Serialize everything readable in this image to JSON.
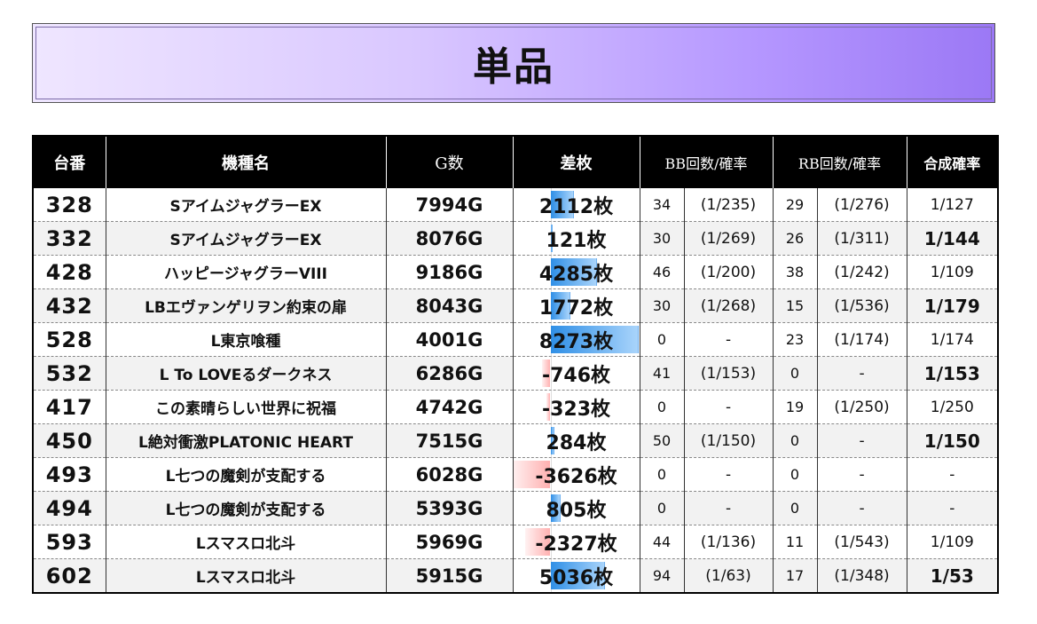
{
  "title": "単品",
  "headers": {
    "machine_no": "台番",
    "model": "機種名",
    "games": "G数",
    "diff": "差枚",
    "bb": "BB回数/確率",
    "rb": "RB回数/確率",
    "combined": "合成確率"
  },
  "diff_scale_max": 8273,
  "rows": [
    {
      "no": "328",
      "model": "SアイムジャグラーEX",
      "games": "7994G",
      "diff": "2112枚",
      "diff_value": 2112,
      "bb": "34",
      "bb_prob": "(1/235)",
      "rb": "29",
      "rb_prob": "(1/276)",
      "combined": "1/127",
      "emph": false
    },
    {
      "no": "332",
      "model": "SアイムジャグラーEX",
      "games": "8076G",
      "diff": "121枚",
      "diff_value": 121,
      "bb": "30",
      "bb_prob": "(1/269)",
      "rb": "26",
      "rb_prob": "(1/311)",
      "combined": "1/144",
      "emph": true
    },
    {
      "no": "428",
      "model": "ハッピージャグラーVIII",
      "games": "9186G",
      "diff": "4285枚",
      "diff_value": 4285,
      "bb": "46",
      "bb_prob": "(1/200)",
      "rb": "38",
      "rb_prob": "(1/242)",
      "combined": "1/109",
      "emph": false
    },
    {
      "no": "432",
      "model": "LBエヴァンゲリヲン約束の扉",
      "games": "8043G",
      "diff": "1772枚",
      "diff_value": 1772,
      "bb": "30",
      "bb_prob": "(1/268)",
      "rb": "15",
      "rb_prob": "(1/536)",
      "combined": "1/179",
      "emph": true
    },
    {
      "no": "528",
      "model": "L東京喰種",
      "games": "4001G",
      "diff": "8273枚",
      "diff_value": 8273,
      "bb": "0",
      "bb_prob": "-",
      "rb": "23",
      "rb_prob": "(1/174)",
      "combined": "1/174",
      "emph": false
    },
    {
      "no": "532",
      "model": "L To LOVEるダークネス",
      "games": "6286G",
      "diff": "-746枚",
      "diff_value": -746,
      "bb": "41",
      "bb_prob": "(1/153)",
      "rb": "0",
      "rb_prob": "-",
      "combined": "1/153",
      "emph": true
    },
    {
      "no": "417",
      "model": "この素晴らしい世界に祝福",
      "games": "4742G",
      "diff": "-323枚",
      "diff_value": -323,
      "bb": "0",
      "bb_prob": "-",
      "rb": "19",
      "rb_prob": "(1/250)",
      "combined": "1/250",
      "emph": false
    },
    {
      "no": "450",
      "model": "L絶対衝激PLATONIC HEART",
      "games": "7515G",
      "diff": "284枚",
      "diff_value": 284,
      "bb": "50",
      "bb_prob": "(1/150)",
      "rb": "0",
      "rb_prob": "-",
      "combined": "1/150",
      "emph": true
    },
    {
      "no": "493",
      "model": "L七つの魔剣が支配する",
      "games": "6028G",
      "diff": "-3626枚",
      "diff_value": -3626,
      "bb": "0",
      "bb_prob": "-",
      "rb": "0",
      "rb_prob": "-",
      "combined": "-",
      "emph": false
    },
    {
      "no": "494",
      "model": "L七つの魔剣が支配する",
      "games": "5393G",
      "diff": "805枚",
      "diff_value": 805,
      "bb": "0",
      "bb_prob": "-",
      "rb": "0",
      "rb_prob": "-",
      "combined": "-",
      "emph": false
    },
    {
      "no": "593",
      "model": "Lスマスロ北斗",
      "games": "5969G",
      "diff": "-2327枚",
      "diff_value": -2327,
      "bb": "44",
      "bb_prob": "(1/136)",
      "rb": "11",
      "rb_prob": "(1/543)",
      "combined": "1/109",
      "emph": false
    },
    {
      "no": "602",
      "model": "Lスマスロ北斗",
      "games": "5915G",
      "diff": "5036枚",
      "diff_value": 5036,
      "bb": "94",
      "bb_prob": "(1/63)",
      "rb": "17",
      "rb_prob": "(1/348)",
      "combined": "1/53",
      "emph": true
    }
  ]
}
